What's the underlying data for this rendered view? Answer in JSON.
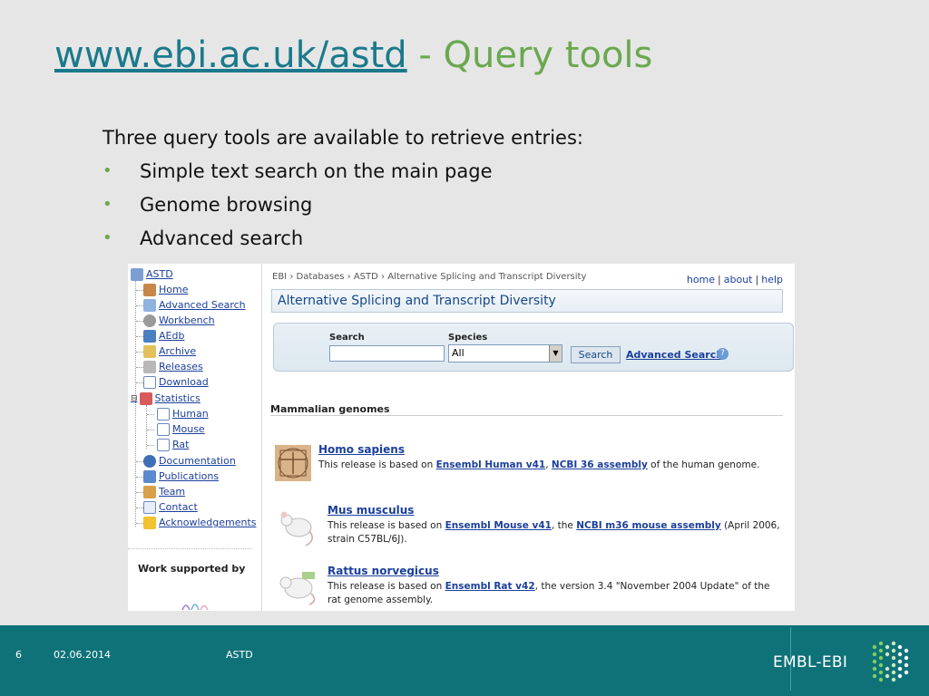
{
  "slide": {
    "title_link": "www.ebi.ac.uk/astd",
    "title_rest": " - Query tools",
    "intro": "Three query tools are available to retrieve entries:",
    "bullets": [
      "Simple text search on the main page",
      "Genome browsing",
      "Advanced search"
    ]
  },
  "screenshot": {
    "tree": {
      "root": "ASTD",
      "items": [
        "Home",
        "Advanced Search",
        "Workbench",
        "AEdb",
        "Archive",
        "Releases",
        "Download",
        "Statistics"
      ],
      "sub_items": [
        "Human",
        "Mouse",
        "Rat"
      ],
      "items_after": [
        "Documentation",
        "Publications",
        "Team",
        "Contact",
        "Acknowledgements"
      ],
      "work_supported": "Work supported by"
    },
    "breadcrumb": [
      "EBI",
      "Databases",
      "ASTD",
      "Alternative Splicing and Transcript Diversity"
    ],
    "top_links": [
      "home",
      "about",
      "help"
    ],
    "header": "Alternative Splicing and Transcript Diversity",
    "search": {
      "search_label": "Search",
      "species_label": "Species",
      "species_value": "All",
      "search_button": "Search",
      "advanced_link": "Advanced Search"
    },
    "section_title": "Mammalian genomes",
    "genomes": [
      {
        "name": "Homo sapiens",
        "pre": "This release is based on ",
        "link1": "Ensembl Human v41",
        "mid": ", ",
        "link2": "NCBI 36 assembly",
        "post": " of the human genome."
      },
      {
        "name": "Mus musculus",
        "pre": "This release is based on ",
        "link1": "Ensembl Mouse v41",
        "mid": ", the ",
        "link2": "NCBI m36 mouse assembly",
        "post": " (April 2006, strain C57BL/6J)."
      },
      {
        "name": "Rattus norvegicus",
        "pre": "This release is based on ",
        "link1": "Ensembl Rat v42",
        "mid": ", the version 3.4 \"November 2004 Update\" of the rat genome assembly.",
        "link2": "",
        "post": ""
      }
    ]
  },
  "footer": {
    "slide_number": "6",
    "date": "02.06.2014",
    "short_title": "ASTD",
    "logo_text": "EMBL-EBI"
  },
  "colors": {
    "title_link": "#1a7a8c",
    "accent_green": "#6aa84f",
    "footer_bg": "#0f7279",
    "link_blue": "#1b3f9c"
  }
}
